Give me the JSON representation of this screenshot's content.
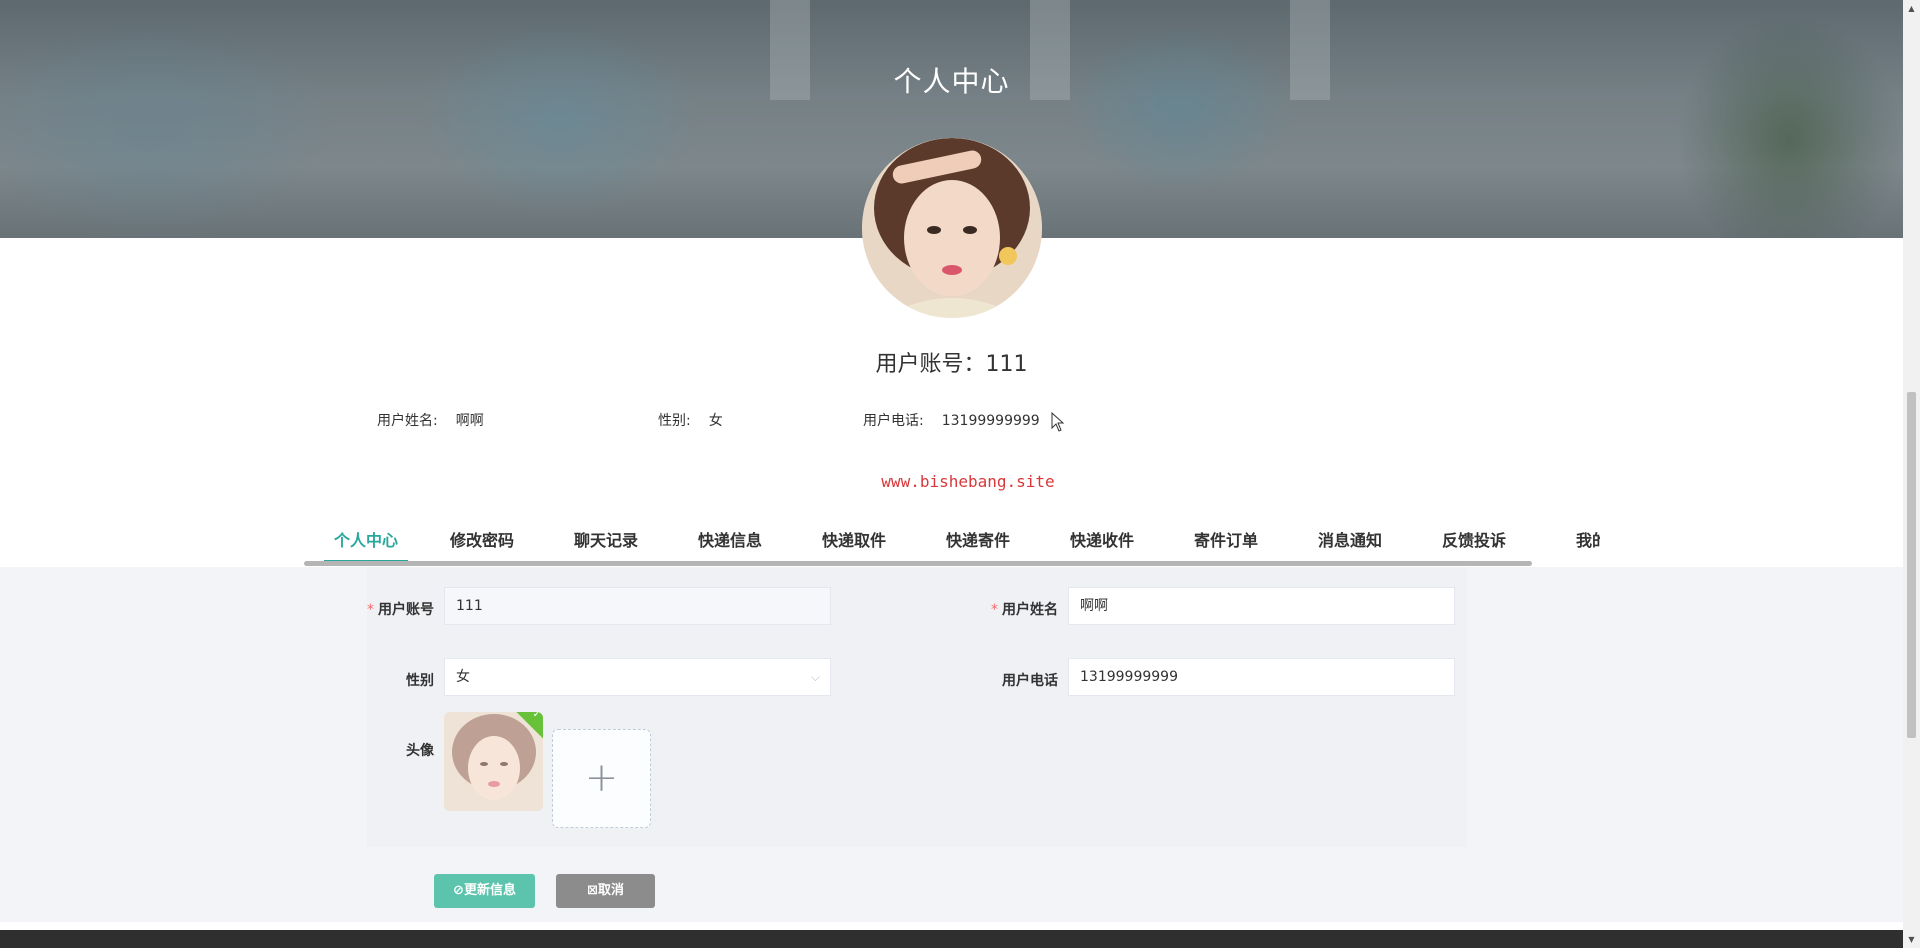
{
  "banner": {
    "title": "个人中心"
  },
  "profile": {
    "account_label": "用户账号：",
    "account_value": "111",
    "name_label": "用户姓名:",
    "name_value": "啊啊",
    "gender_label": "性别:",
    "gender_value": "女",
    "phone_label": "用户电话:",
    "phone_value": "13199999999"
  },
  "watermark": "www.bishebang.site",
  "tabs": [
    {
      "label": "个人中心",
      "active": true
    },
    {
      "label": "修改密码",
      "active": false
    },
    {
      "label": "聊天记录",
      "active": false
    },
    {
      "label": "快递信息",
      "active": false
    },
    {
      "label": "快递取件",
      "active": false
    },
    {
      "label": "快递寄件",
      "active": false
    },
    {
      "label": "快递收件",
      "active": false
    },
    {
      "label": "寄件订单",
      "active": false
    },
    {
      "label": "消息通知",
      "active": false
    },
    {
      "label": "反馈投诉",
      "active": false
    },
    {
      "label": "我的",
      "active": false
    }
  ],
  "form": {
    "account": {
      "label": "用户账号",
      "value": "111",
      "required": true,
      "disabled": true
    },
    "name": {
      "label": "用户姓名",
      "value": "啊啊",
      "required": true
    },
    "gender": {
      "label": "性别",
      "value": "女"
    },
    "phone": {
      "label": "用户电话",
      "value": "13199999999"
    },
    "avatar": {
      "label": "头像",
      "add_symbol": "+"
    }
  },
  "buttons": {
    "update": "更新信息",
    "cancel": "取消"
  },
  "colors": {
    "accent": "#2aa79b",
    "update_button": "#5cc3ad",
    "cancel_button": "#8c8c8c",
    "watermark": "#d9383a",
    "required_mark": "#f56c6c"
  }
}
